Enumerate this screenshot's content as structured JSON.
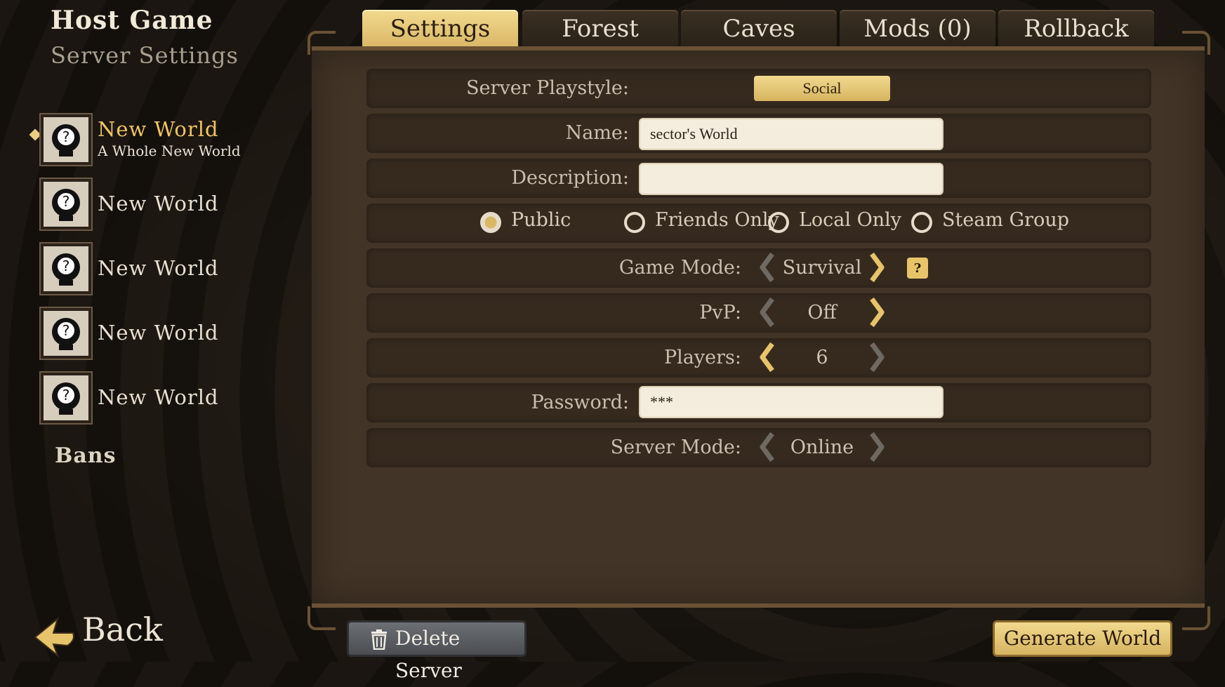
{
  "header": {
    "title": "Host Game",
    "subtitle": "Server Settings"
  },
  "slots": [
    {
      "name": "New World",
      "description": "A Whole New World",
      "active": true
    },
    {
      "name": "New World"
    },
    {
      "name": "New World"
    },
    {
      "name": "New World"
    },
    {
      "name": "New World"
    }
  ],
  "sidebar": {
    "bans_label": "Bans",
    "back_label": "Back"
  },
  "tabs": [
    {
      "label": "Settings",
      "active": true
    },
    {
      "label": "Forest"
    },
    {
      "label": "Caves"
    },
    {
      "label": "Mods (0)"
    },
    {
      "label": "Rollback"
    }
  ],
  "settings": {
    "playstyle_label": "Server Playstyle:",
    "playstyle_value": "Social",
    "name_label": "Name:",
    "name_value": "sector's World",
    "description_label": "Description:",
    "description_value": "",
    "visibility": [
      {
        "label": "Public",
        "selected": true
      },
      {
        "label": "Friends Only",
        "selected": false
      },
      {
        "label": "Local Only",
        "selected": false
      },
      {
        "label": "Steam Group",
        "selected": false
      }
    ],
    "game_mode_label": "Game Mode:",
    "game_mode_value": "Survival",
    "pvp_label": "PvP:",
    "pvp_value": "Off",
    "players_label": "Players:",
    "players_value": "6",
    "password_label": "Password:",
    "password_value": "***",
    "server_mode_label": "Server Mode:",
    "server_mode_value": "Online"
  },
  "buttons": {
    "delete_label": "Delete Server",
    "generate_label": "Generate World"
  },
  "icons": {
    "help": "question-mark-icon",
    "delete": "trash-icon",
    "back": "back-arrow-icon",
    "avatar": "mystery-character-icon"
  },
  "colors": {
    "accent_gold": "#e7c46a",
    "panel_brown": "#423426",
    "active_slot_name": "#f0c560"
  }
}
